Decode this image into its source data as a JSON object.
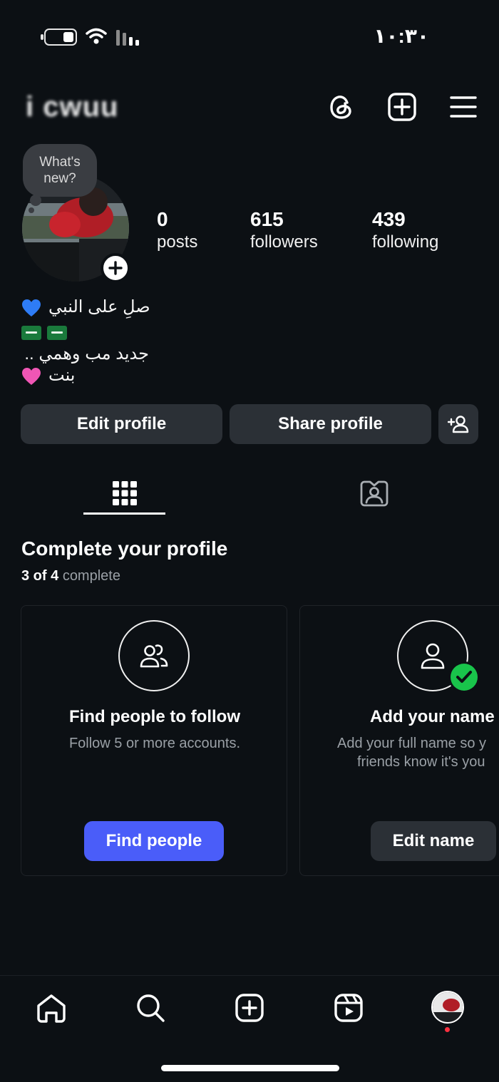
{
  "status_bar": {
    "time": "١٠:٣٠"
  },
  "header": {
    "username": "i cwuu",
    "icons": [
      "threads-icon",
      "create-icon",
      "menu-icon"
    ]
  },
  "profile": {
    "note": "What's new?",
    "stats": [
      {
        "value": "0",
        "label": "posts"
      },
      {
        "value": "615",
        "label": "followers"
      },
      {
        "value": "439",
        "label": "following"
      }
    ],
    "bio": {
      "line1": "صلِ على النبي",
      "line3": "جديد مب وهمي ..",
      "line4": "بنت"
    }
  },
  "actions": {
    "edit_profile": "Edit profile",
    "share_profile": "Share profile"
  },
  "tabs": [
    "grid",
    "tagged"
  ],
  "complete_profile": {
    "title": "Complete your profile",
    "progress_done": "3 of 4",
    "progress_suffix": "complete",
    "cards": [
      {
        "title": "Find people to follow",
        "desc": "Follow 5 or more accounts.",
        "button": "Find people",
        "done": false
      },
      {
        "title": "Add your name",
        "desc_line1": "Add your full name so y",
        "desc_line2": "friends know it's you",
        "button": "Edit name",
        "done": true
      }
    ]
  },
  "bottom_nav": [
    "home",
    "search",
    "create",
    "reels",
    "profile"
  ],
  "colors": {
    "background": "#0c1014",
    "button": "#2b3036",
    "primary": "#4a5df9",
    "success": "#19c44b"
  }
}
